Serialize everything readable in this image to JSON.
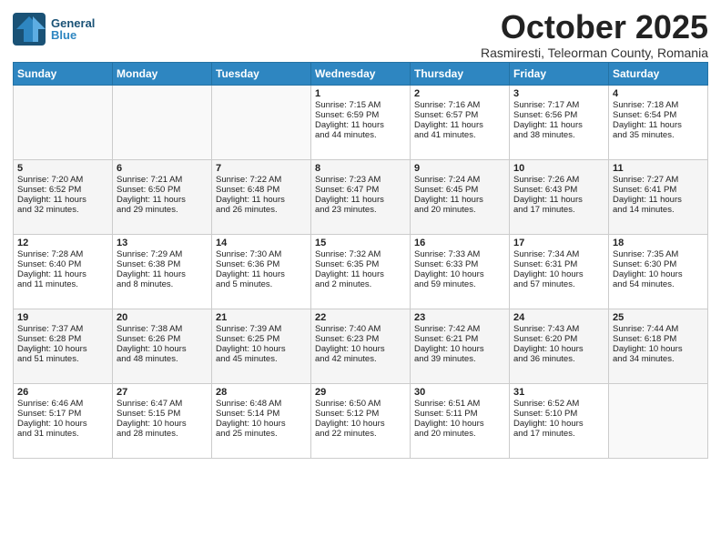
{
  "header": {
    "logo_general": "General",
    "logo_blue": "Blue",
    "month_title": "October 2025",
    "subtitle": "Rasmiresti, Teleorman County, Romania"
  },
  "days_of_week": [
    "Sunday",
    "Monday",
    "Tuesday",
    "Wednesday",
    "Thursday",
    "Friday",
    "Saturday"
  ],
  "weeks": [
    [
      {
        "day": "",
        "content": ""
      },
      {
        "day": "",
        "content": ""
      },
      {
        "day": "",
        "content": ""
      },
      {
        "day": "1",
        "content": "Sunrise: 7:15 AM\nSunset: 6:59 PM\nDaylight: 11 hours\nand 44 minutes."
      },
      {
        "day": "2",
        "content": "Sunrise: 7:16 AM\nSunset: 6:57 PM\nDaylight: 11 hours\nand 41 minutes."
      },
      {
        "day": "3",
        "content": "Sunrise: 7:17 AM\nSunset: 6:56 PM\nDaylight: 11 hours\nand 38 minutes."
      },
      {
        "day": "4",
        "content": "Sunrise: 7:18 AM\nSunset: 6:54 PM\nDaylight: 11 hours\nand 35 minutes."
      }
    ],
    [
      {
        "day": "5",
        "content": "Sunrise: 7:20 AM\nSunset: 6:52 PM\nDaylight: 11 hours\nand 32 minutes."
      },
      {
        "day": "6",
        "content": "Sunrise: 7:21 AM\nSunset: 6:50 PM\nDaylight: 11 hours\nand 29 minutes."
      },
      {
        "day": "7",
        "content": "Sunrise: 7:22 AM\nSunset: 6:48 PM\nDaylight: 11 hours\nand 26 minutes."
      },
      {
        "day": "8",
        "content": "Sunrise: 7:23 AM\nSunset: 6:47 PM\nDaylight: 11 hours\nand 23 minutes."
      },
      {
        "day": "9",
        "content": "Sunrise: 7:24 AM\nSunset: 6:45 PM\nDaylight: 11 hours\nand 20 minutes."
      },
      {
        "day": "10",
        "content": "Sunrise: 7:26 AM\nSunset: 6:43 PM\nDaylight: 11 hours\nand 17 minutes."
      },
      {
        "day": "11",
        "content": "Sunrise: 7:27 AM\nSunset: 6:41 PM\nDaylight: 11 hours\nand 14 minutes."
      }
    ],
    [
      {
        "day": "12",
        "content": "Sunrise: 7:28 AM\nSunset: 6:40 PM\nDaylight: 11 hours\nand 11 minutes."
      },
      {
        "day": "13",
        "content": "Sunrise: 7:29 AM\nSunset: 6:38 PM\nDaylight: 11 hours\nand 8 minutes."
      },
      {
        "day": "14",
        "content": "Sunrise: 7:30 AM\nSunset: 6:36 PM\nDaylight: 11 hours\nand 5 minutes."
      },
      {
        "day": "15",
        "content": "Sunrise: 7:32 AM\nSunset: 6:35 PM\nDaylight: 11 hours\nand 2 minutes."
      },
      {
        "day": "16",
        "content": "Sunrise: 7:33 AM\nSunset: 6:33 PM\nDaylight: 10 hours\nand 59 minutes."
      },
      {
        "day": "17",
        "content": "Sunrise: 7:34 AM\nSunset: 6:31 PM\nDaylight: 10 hours\nand 57 minutes."
      },
      {
        "day": "18",
        "content": "Sunrise: 7:35 AM\nSunset: 6:30 PM\nDaylight: 10 hours\nand 54 minutes."
      }
    ],
    [
      {
        "day": "19",
        "content": "Sunrise: 7:37 AM\nSunset: 6:28 PM\nDaylight: 10 hours\nand 51 minutes."
      },
      {
        "day": "20",
        "content": "Sunrise: 7:38 AM\nSunset: 6:26 PM\nDaylight: 10 hours\nand 48 minutes."
      },
      {
        "day": "21",
        "content": "Sunrise: 7:39 AM\nSunset: 6:25 PM\nDaylight: 10 hours\nand 45 minutes."
      },
      {
        "day": "22",
        "content": "Sunrise: 7:40 AM\nSunset: 6:23 PM\nDaylight: 10 hours\nand 42 minutes."
      },
      {
        "day": "23",
        "content": "Sunrise: 7:42 AM\nSunset: 6:21 PM\nDaylight: 10 hours\nand 39 minutes."
      },
      {
        "day": "24",
        "content": "Sunrise: 7:43 AM\nSunset: 6:20 PM\nDaylight: 10 hours\nand 36 minutes."
      },
      {
        "day": "25",
        "content": "Sunrise: 7:44 AM\nSunset: 6:18 PM\nDaylight: 10 hours\nand 34 minutes."
      }
    ],
    [
      {
        "day": "26",
        "content": "Sunrise: 6:46 AM\nSunset: 5:17 PM\nDaylight: 10 hours\nand 31 minutes."
      },
      {
        "day": "27",
        "content": "Sunrise: 6:47 AM\nSunset: 5:15 PM\nDaylight: 10 hours\nand 28 minutes."
      },
      {
        "day": "28",
        "content": "Sunrise: 6:48 AM\nSunset: 5:14 PM\nDaylight: 10 hours\nand 25 minutes."
      },
      {
        "day": "29",
        "content": "Sunrise: 6:50 AM\nSunset: 5:12 PM\nDaylight: 10 hours\nand 22 minutes."
      },
      {
        "day": "30",
        "content": "Sunrise: 6:51 AM\nSunset: 5:11 PM\nDaylight: 10 hours\nand 20 minutes."
      },
      {
        "day": "31",
        "content": "Sunrise: 6:52 AM\nSunset: 5:10 PM\nDaylight: 10 hours\nand 17 minutes."
      },
      {
        "day": "",
        "content": ""
      }
    ]
  ]
}
